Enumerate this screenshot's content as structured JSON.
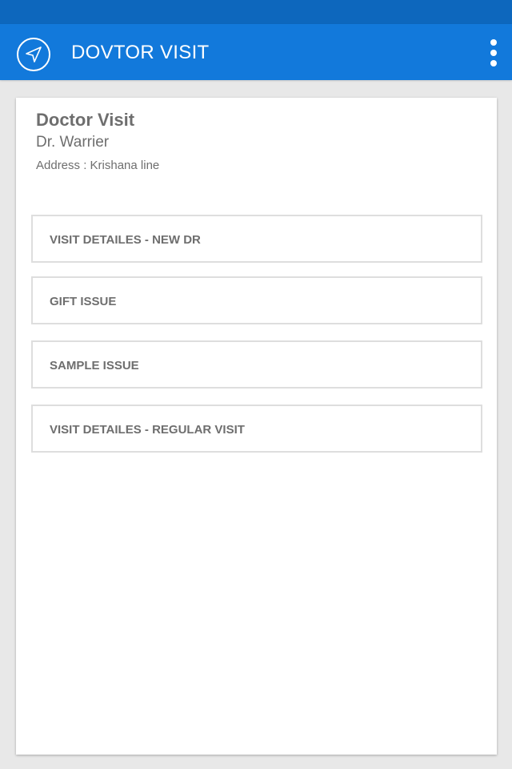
{
  "app_bar": {
    "title": "DOVTOR VISIT",
    "nav_icon": "navigation-arrow-icon",
    "menu_icon": "more-vertical-icon"
  },
  "visit": {
    "heading": "Doctor Visit",
    "doctor_name": "Dr. Warrier",
    "address": "Address : Krishana line"
  },
  "options": [
    {
      "label": "VISIT DETAILES - NEW DR"
    },
    {
      "label": "GIFT ISSUE"
    },
    {
      "label": "SAMPLE ISSUE"
    },
    {
      "label": "VISIT DETAILES - REGULAR VISIT"
    }
  ],
  "colors": {
    "status_bar": "#0d67bd",
    "app_bar": "#1279db",
    "background": "#e8e8e8",
    "text": "#6e6e6e"
  }
}
